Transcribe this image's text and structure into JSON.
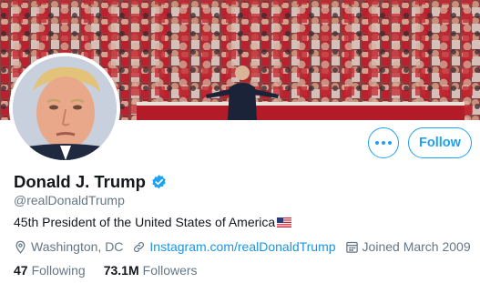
{
  "profile": {
    "display_name": "Donald J. Trump",
    "handle": "@realDonaldTrump",
    "bio": "45th President of the United States of America",
    "verified": true,
    "location": "Washington, DC",
    "website": "Instagram.com/realDonaldTrump",
    "joined": "Joined March 2009"
  },
  "counts": {
    "following_value": "47",
    "following_label": "Following",
    "followers_value": "73.1M",
    "followers_label": "Followers"
  },
  "actions": {
    "follow_label": "Follow",
    "more_icon": "more-options-icon"
  },
  "icons": {
    "verified": "verified-badge-icon",
    "flag": "us-flag-icon",
    "location": "location-pin-icon",
    "link": "link-icon",
    "calendar": "calendar-icon"
  },
  "colors": {
    "accent": "#1da1f2",
    "link": "#1b95e0",
    "secondary_text": "#657786",
    "primary_text": "#14171a"
  }
}
